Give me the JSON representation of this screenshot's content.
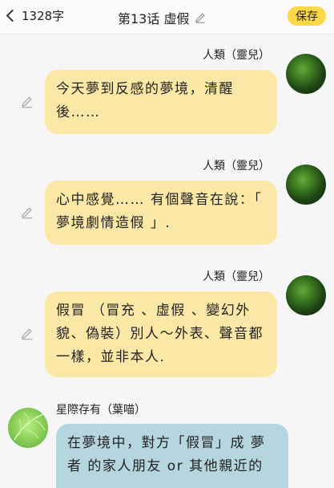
{
  "header": {
    "back_count": "1328字",
    "title": "第13话 虛假",
    "save_label": "保存"
  },
  "messages": [
    {
      "sender": "人類（靈兒）",
      "text": "今天夢到反感的夢境，清醒後……"
    },
    {
      "sender": "人類（靈兒）",
      "text": "心中感覺…… 有個聲音在說：「 夢境劇情造假 」."
    },
    {
      "sender": "人類（靈兒）",
      "text": "假冒 （冒充 、虛假 、變幻外貌、偽裝）別人～外表、聲音都一樣，並非本人."
    },
    {
      "sender": "星際存有（葉喵）",
      "text": "在夢境中，對方「假冒」成 夢者 的家人朋友 or 其他親近的"
    }
  ],
  "icons": {
    "back": "chevron-left-icon",
    "title_edit": "pencil-icon",
    "message_edit": "pencil-icon"
  },
  "colors": {
    "save_button": "#ffd84a",
    "bubble_human": "#fce8a6",
    "bubble_star": "#b5d6df"
  }
}
